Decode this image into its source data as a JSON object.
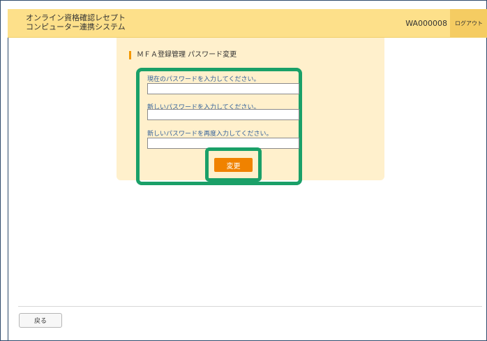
{
  "header": {
    "app_title_line1": "オンライン資格確認レセプト",
    "app_title_line2": "コンピューター連携システム",
    "user_id": "WA000008",
    "logout_label": "ログアウト"
  },
  "main": {
    "section_title": "ＭＦＡ登録管理 パスワード変更",
    "fields": [
      {
        "label": "現在のパスワードを入力してください。",
        "value": ""
      },
      {
        "label": "新しいパスワードを入力してください。",
        "value": ""
      },
      {
        "label": "新しいパスワードを再度入力してください。",
        "value": ""
      }
    ],
    "submit_label": "変更"
  },
  "footer": {
    "back_label": "戻る"
  },
  "colors": {
    "header_bg": "#fde08a",
    "panel_bg": "#fff0cc",
    "accent_orange": "#f08200",
    "highlight_green": "#1aa068",
    "label_blue": "#2f5f9a"
  }
}
